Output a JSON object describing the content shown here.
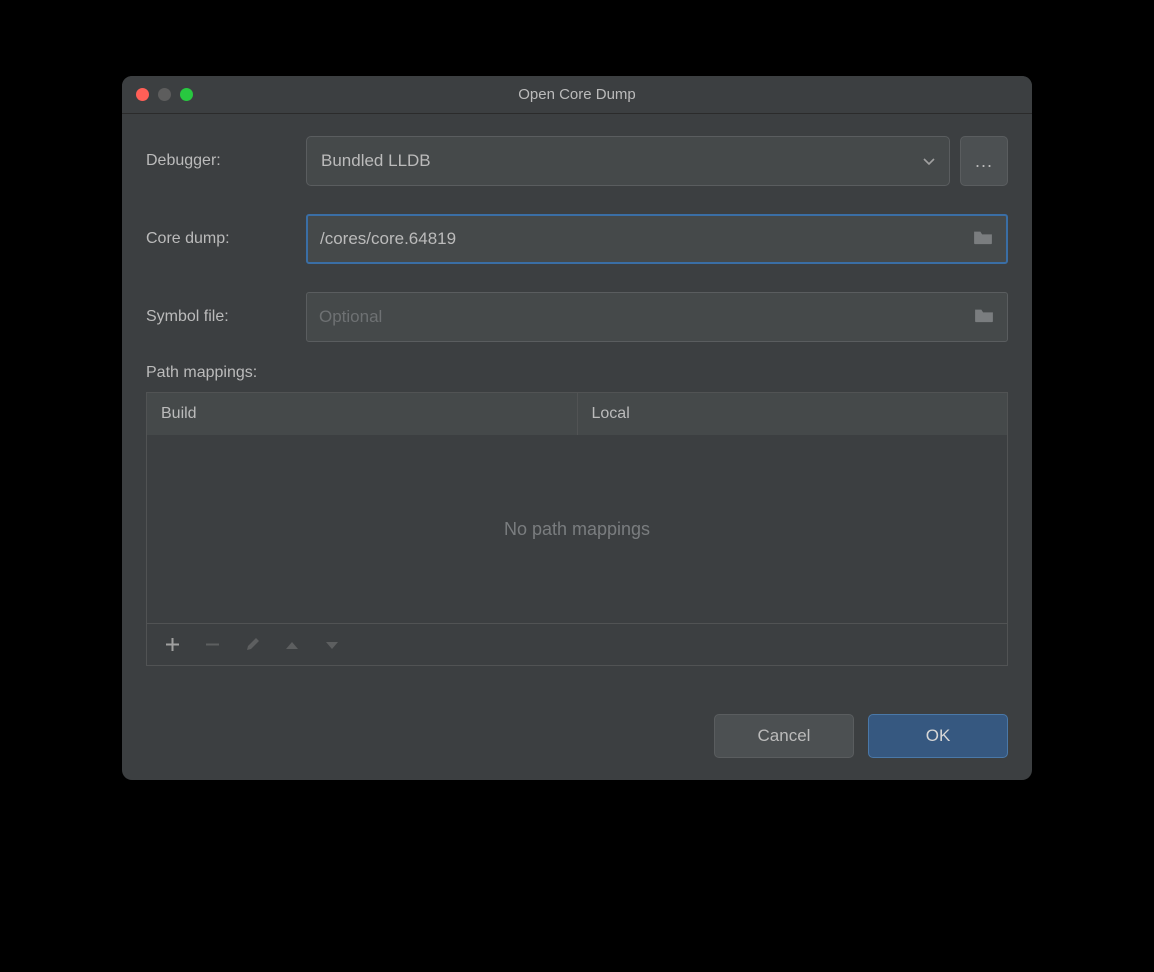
{
  "window": {
    "title": "Open Core Dump"
  },
  "form": {
    "debugger": {
      "label": "Debugger:",
      "value": "Bundled LLDB",
      "ellipsis": "..."
    },
    "coredump": {
      "label": "Core dump:",
      "value": "/cores/core.64819"
    },
    "symbolfile": {
      "label": "Symbol file:",
      "placeholder": "Optional",
      "value": ""
    },
    "pathmappings": {
      "label": "Path mappings:",
      "columns": [
        "Build",
        "Local"
      ],
      "empty": "No path mappings"
    }
  },
  "buttons": {
    "cancel": "Cancel",
    "ok": "OK"
  }
}
